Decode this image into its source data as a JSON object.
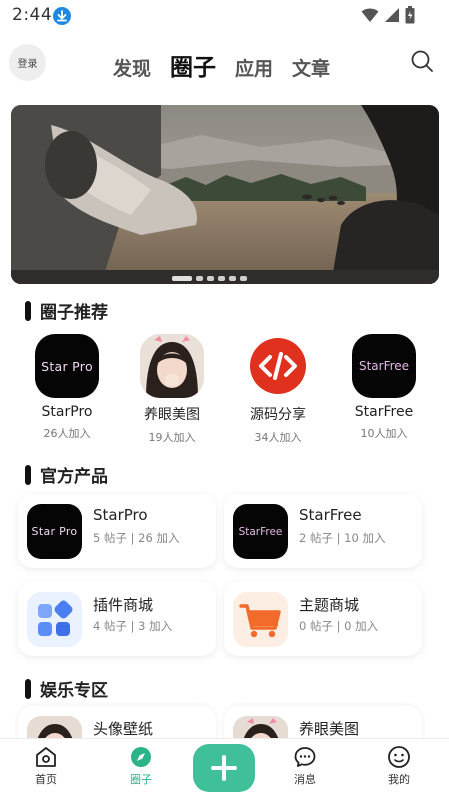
{
  "status_bar": {
    "time": "2:44"
  },
  "header": {
    "login_label": "登录",
    "tabs": [
      {
        "label": "发现",
        "active": false
      },
      {
        "label": "圈子",
        "active": true
      },
      {
        "label": "应用",
        "active": false
      },
      {
        "label": "文章",
        "active": false
      }
    ]
  },
  "banner": {
    "page_count": 6,
    "active_index": 0
  },
  "circle_section": {
    "title": "圈子推荐",
    "items": [
      {
        "logo_text": "Star Pro",
        "name": "StarPro",
        "members": "26人加入"
      },
      {
        "name": "养眼美图",
        "members": "19人加入"
      },
      {
        "name": "源码分享",
        "members": "34人加入"
      },
      {
        "logo_text": "StarFree",
        "name": "StarFree",
        "members": "10人加入"
      }
    ]
  },
  "products_section": {
    "title": "官方产品",
    "cards": [
      {
        "logo_text": "Star Pro",
        "title": "StarPro",
        "meta": "5 帖子 | 26 加入"
      },
      {
        "logo_text": "StarFree",
        "title": "StarFree",
        "meta": "2 帖子 | 10 加入"
      },
      {
        "title": "插件商城",
        "meta": "4 帖子 | 3 加入"
      },
      {
        "title": "主题商城",
        "meta": "0 帖子 | 0 加入"
      }
    ]
  },
  "entertainment_section": {
    "title": "娱乐专区",
    "cards": [
      {
        "title": "头像壁纸"
      },
      {
        "title": "养眼美图"
      }
    ]
  },
  "bottom_nav": {
    "items": [
      {
        "label": "首页",
        "active": false
      },
      {
        "label": "圈子",
        "active": true
      },
      {
        "label": "消息",
        "active": false
      },
      {
        "label": "我的",
        "active": false
      }
    ]
  },
  "colors": {
    "accent": "#3fc09a",
    "active_nav": "#2bb38a",
    "code_red": "#e0311f",
    "cart_orange": "#f26b2a",
    "plugin_blue": "#5b8df6"
  }
}
